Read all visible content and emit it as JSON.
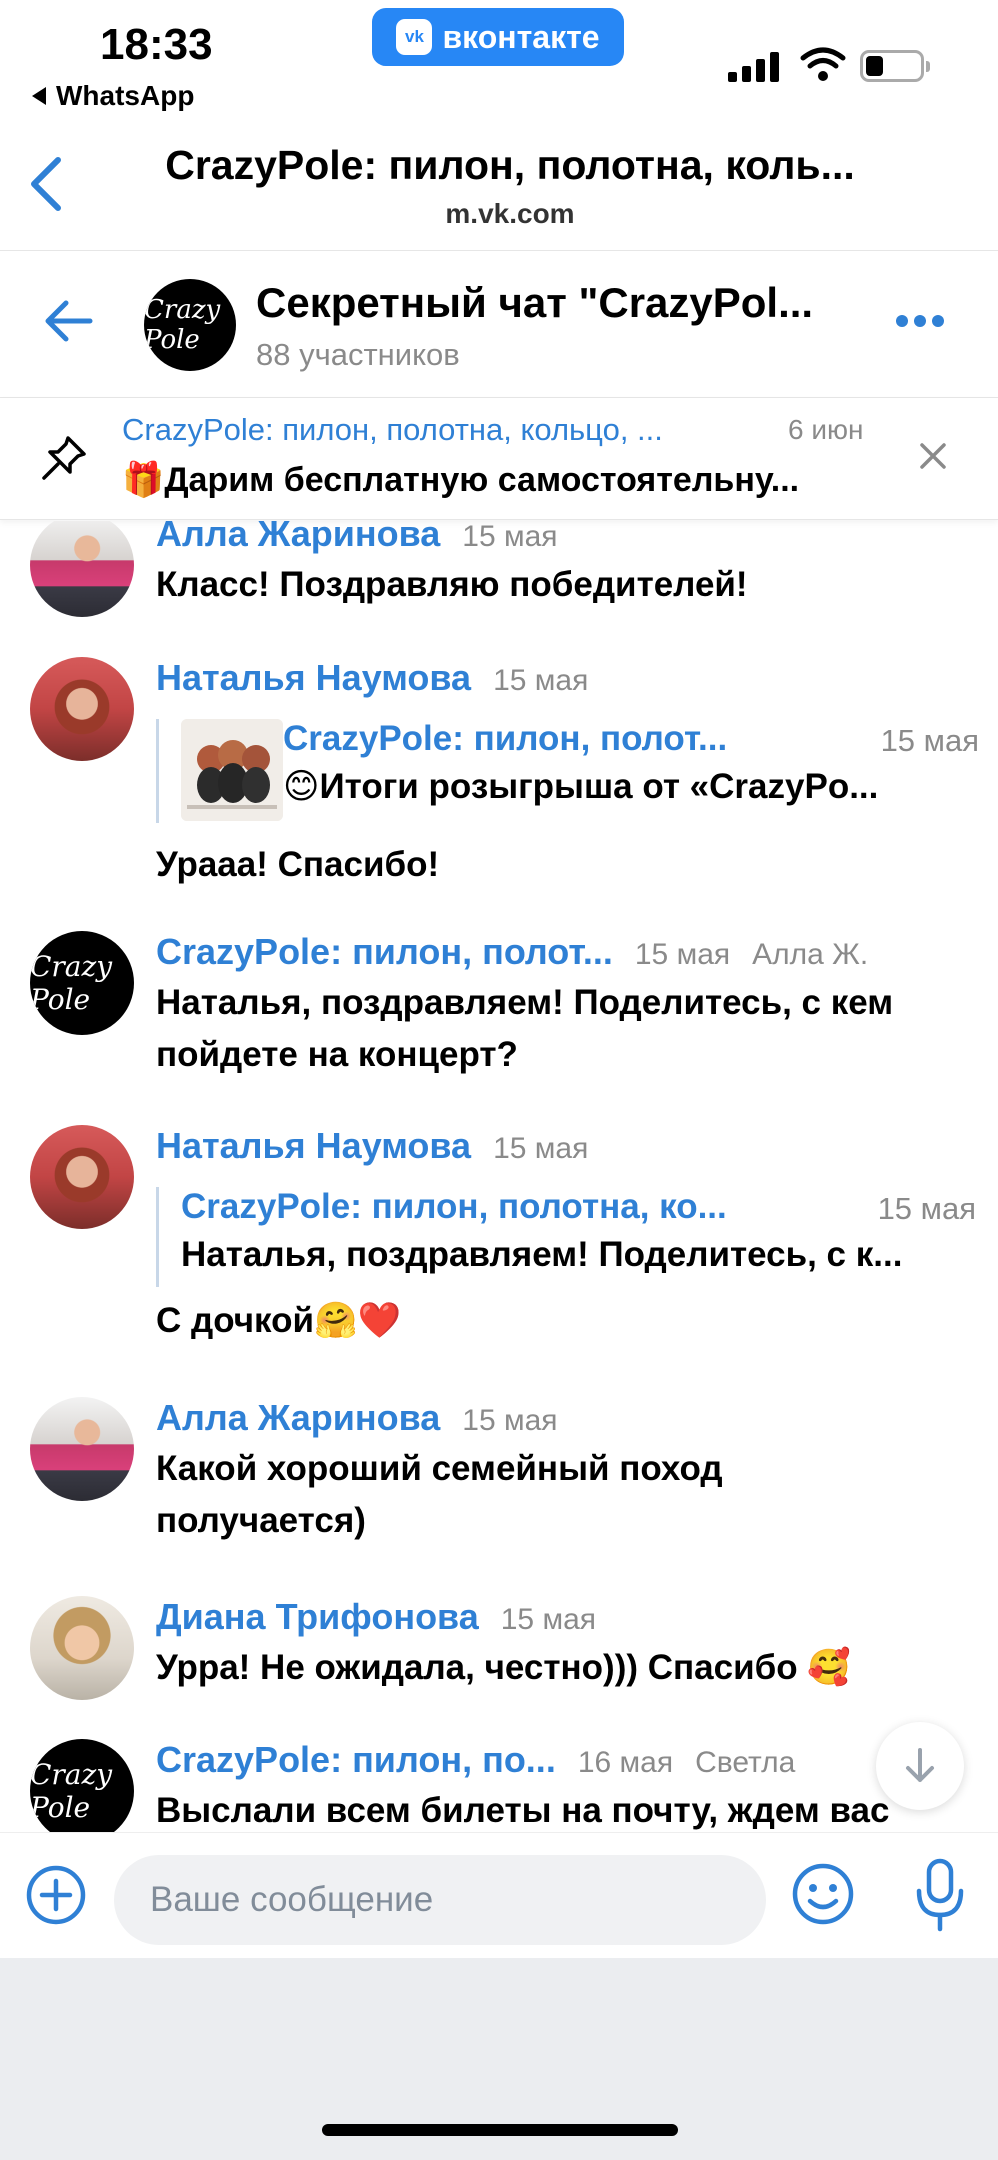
{
  "status_bar": {
    "time": "18:33",
    "back_app": "WhatsApp",
    "app_pill": "вконтакте",
    "app_pill_logo": "vk"
  },
  "browser": {
    "title": "CrazyPole: пилон, полотна, коль...",
    "url": "m.vk.com"
  },
  "chat": {
    "title": "Секретный чат \"CrazyPol...",
    "subtitle": "88 участников",
    "avatar_text": "Crazy Pole"
  },
  "pinned": {
    "author": "CrazyPole: пилон, полотна, кольцо, ...",
    "date": "6 июн",
    "text": "🎁Дарим бесплатную самостоятельну..."
  },
  "messages": [
    {
      "author": "Алла Жаринова",
      "date": "15 мая",
      "text": "Класс! Поздравляю победителей!"
    },
    {
      "author": "Наталья Наумова",
      "date": "15 мая",
      "reply": {
        "author": "CrazyPole: пилон, полот...",
        "date": "15 мая",
        "text": "😊Итоги розыгрыша от «CrazyPo..."
      },
      "text": "Урааа! Спасибо!"
    },
    {
      "author": "CrazyPole: пилон, полот...",
      "date": "15 мая",
      "extra": "Алла Ж.",
      "avatar_text": "Crazy Pole",
      "text_lines": [
        "Наталья, поздравляем! Поделитесь, с кем",
        "пойдете на концерт?"
      ]
    },
    {
      "author": "Наталья Наумова",
      "date": "15 мая",
      "reply": {
        "author": "CrazyPole: пилон, полотна, ко...",
        "date": "15 мая",
        "text": "Наталья, поздравляем! Поделитесь, с к..."
      },
      "text": "С дочкой🤗❤️"
    },
    {
      "author": "Алла Жаринова",
      "date": "15 мая",
      "text_lines": [
        "Какой хороший семейный поход",
        "получается)"
      ]
    },
    {
      "author": "Диана Трифонова",
      "date": "15 мая",
      "text": "Урра! Не ожидала, честно))) Спасибо 🥰"
    },
    {
      "author": "CrazyPole: пилон, по...",
      "date": "16 мая",
      "extra": "Светла",
      "avatar_text": "Crazy Pole",
      "text": "Выслали всем билеты на почту, ждем вас"
    }
  ],
  "composer": {
    "placeholder": "Ваше сообщение"
  },
  "colors": {
    "accent": "#2f80d5",
    "vk_blue": "#2787f5",
    "muted": "#8a8a8a",
    "input_bg": "#f0f1f3"
  },
  "icons": [
    "back-chevron-icon",
    "back-arrow-icon",
    "more-dots-icon",
    "pin-icon",
    "close-icon",
    "scroll-down-icon",
    "add-icon",
    "emoji-icon",
    "mic-icon",
    "signal-icon",
    "wifi-icon",
    "battery-icon"
  ]
}
